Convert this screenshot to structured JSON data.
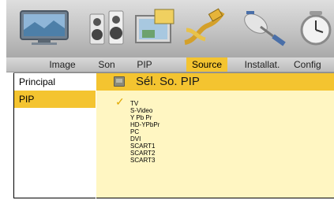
{
  "tabs": [
    {
      "label": "Image",
      "active": false
    },
    {
      "label": "Son",
      "active": false
    },
    {
      "label": "PIP",
      "active": false
    },
    {
      "label": "Source",
      "active": true
    },
    {
      "label": "Installat.",
      "active": false
    },
    {
      "label": "Config",
      "active": false
    }
  ],
  "sidebar": {
    "items": [
      {
        "label": "Principal",
        "active": false
      },
      {
        "label": "PIP",
        "active": true
      }
    ]
  },
  "panel": {
    "title": "Sél. So. PIP",
    "header_icon": "tv-icon",
    "options": [
      "TV",
      "S-Video",
      "Y Pb Pr",
      "HD-YPbPr",
      "PC",
      "DVI",
      "SCART1",
      "SCART2",
      "SCART3"
    ],
    "selected": "TV",
    "check_glyph": "✓"
  },
  "top_icons": [
    "tv-picture-icon",
    "speakers-icon",
    "pip-screens-icon",
    "source-cables-icon",
    "satellite-dish-icon",
    "clock-icon"
  ],
  "colors": {
    "accent": "#f4c430",
    "panel_bg": "#fff6c2",
    "check": "#e0a800"
  }
}
